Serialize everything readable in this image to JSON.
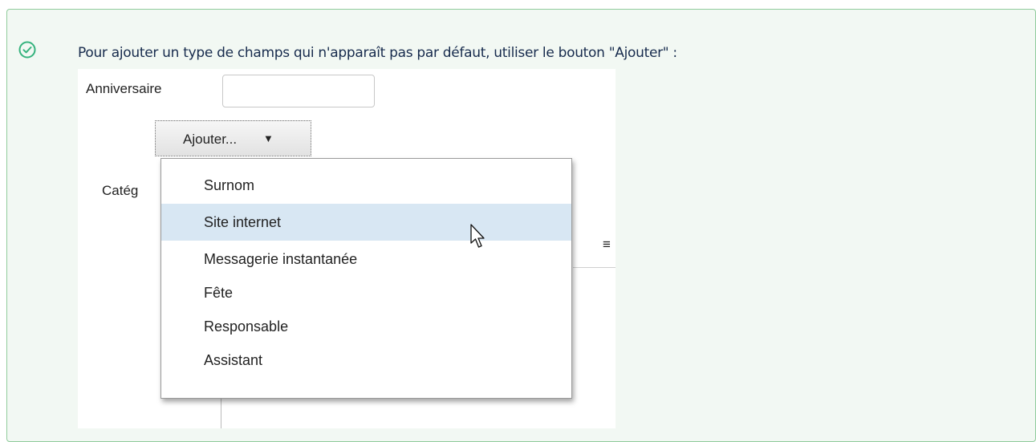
{
  "note": {
    "icon": "check-circle-icon",
    "text": "Pour ajouter un type de champs qui n'apparaît pas par défaut, utiliser le bouton \"Ajouter\" :"
  },
  "screenshot": {
    "anniversary_label": "Anniversaire",
    "anniversary_value": "",
    "add_button_label": "Ajouter...",
    "add_button_arrow": "▼",
    "category_label": "Catég",
    "background_icon": "≡",
    "menu": {
      "items": [
        {
          "label": "Surnom",
          "highlighted": false
        },
        {
          "label": "Site internet",
          "highlighted": true
        },
        {
          "label": "Messagerie instantanée",
          "highlighted": false
        },
        {
          "label": "Fête",
          "highlighted": false
        },
        {
          "label": "Responsable",
          "highlighted": false
        },
        {
          "label": "Assistant",
          "highlighted": false
        }
      ]
    },
    "cursor_icon": "mouse-pointer-icon"
  },
  "colors": {
    "panel_bg": "#f2f8f3",
    "panel_border": "#8fcb9b",
    "check_icon": "#36b37e",
    "highlight": "#d8e7f3"
  }
}
